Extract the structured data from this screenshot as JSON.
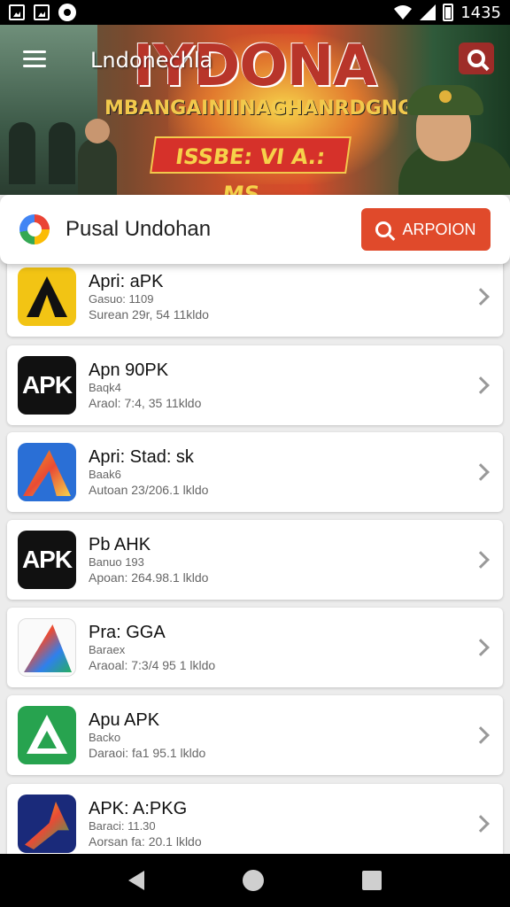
{
  "status_bar": {
    "time": "1435",
    "icons": [
      "image-icon",
      "image-icon",
      "record-icon",
      "wifi-icon",
      "signal-icon",
      "battery-icon"
    ]
  },
  "app_bar": {
    "title": "Lndonechla",
    "menu_icon": "hamburger-icon",
    "search_icon": "search-icon"
  },
  "banner": {
    "headline": "IYDONA",
    "tagline": "MBANGAINIINAGHANRDGNGNGS",
    "badge": "ISSBE: VI A.: MS."
  },
  "search_card": {
    "logo": "g-logo-icon",
    "label": "Pusal Undohan",
    "button_label": "ARPOION",
    "button_icon": "search-icon",
    "accent": "#e04a2b"
  },
  "apps": [
    {
      "title": "Apri: aPK",
      "sub": "Gasuo: 1109",
      "meta": "Surean 29r, 54 11kldo",
      "icon": "a-yellow"
    },
    {
      "title": "Apn 90PK",
      "sub": "Baqk4",
      "meta": "Araol: 7:4, 35 11kldo",
      "icon": "apk-black",
      "icon_text": "APK"
    },
    {
      "title": "Apri: Stad: sk",
      "sub": "Baak6",
      "meta": "Autoan 23/206.1 lkldo",
      "icon": "arrow-blue"
    },
    {
      "title": "Pb AHK",
      "sub": "Banuo 193",
      "meta": "Apoan: 264.98.1 lkldo",
      "icon": "apk-black",
      "icon_text": "APK"
    },
    {
      "title": "Pra: GGA",
      "sub": "Baraex",
      "meta": "Araoal: 7:3/4 95 1 lkldo",
      "icon": "tri-white"
    },
    {
      "title": "Apu APK",
      "sub": "Backo",
      "meta": "Daraoi: fa1 95.1 lkldo",
      "icon": "green-a"
    },
    {
      "title": "APK: A:PKG",
      "sub": "Baraci: 11.30",
      "meta": "Aorsan fa: 20.1 lkldo",
      "icon": "navy-arrow"
    }
  ],
  "nav_bar": {
    "back": "back-icon",
    "home": "home-icon",
    "recent": "recent-apps-icon"
  }
}
